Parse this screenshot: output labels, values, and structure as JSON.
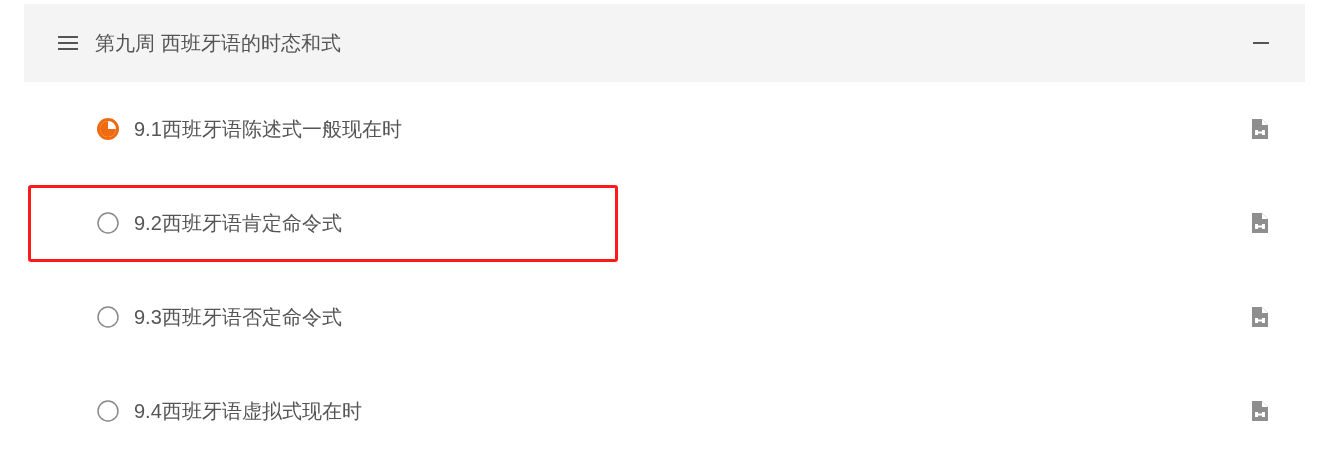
{
  "chapter": {
    "title": "第九周 西班牙语的时态和式",
    "expanded": true,
    "lessons": [
      {
        "title": "9.1西班牙语陈述式一般现在时",
        "kind": "started",
        "highlighted": false
      },
      {
        "title": "9.2西班牙语肯定命令式",
        "kind": "unstarted",
        "highlighted": true
      },
      {
        "title": "9.3西班牙语否定命令式",
        "kind": "unstarted",
        "highlighted": false
      },
      {
        "title": "9.4西班牙语虚拟式现在时",
        "kind": "unstarted",
        "highlighted": false
      }
    ]
  }
}
